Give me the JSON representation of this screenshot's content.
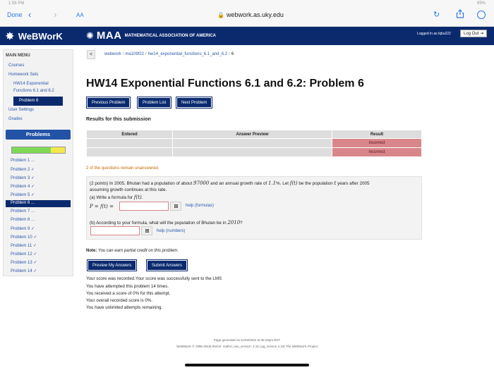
{
  "safari": {
    "done": "Done",
    "aa": "AA",
    "url": "webwork.as.uky.edu",
    "status_time": "1:56 PM",
    "status_right": "89%"
  },
  "header": {
    "logo": "WeBWorK",
    "maa_big": "MAA",
    "maa_small": "MATHEMATICAL ASSOCIATION OF AMERICA",
    "logged_in": "Logged in as lqbu222",
    "logout": "Log Out"
  },
  "sidebar": {
    "menu_title": "MAIN MENU",
    "courses": "Courses",
    "homework_sets": "Homework Sets",
    "hw_line1": "HW14 Exponential",
    "hw_line2": "Functions 6.1 and 6.2",
    "problem_active": "Problem 6",
    "user_settings": "User Settings",
    "grades": "Grades",
    "problems_title": "Problems",
    "progress": {
      "correct_fraction": 0.84,
      "attempted_fraction": 0.26
    },
    "problems": [
      "Problem 1 ...",
      "Problem 2 ✓",
      "Problem 3 ✓",
      "Problem 4 ✓",
      "Problem 5 ✓",
      "Problem 6 ...",
      "Problem 7 ...",
      "Problem 8 ...",
      "Problem 9 ✓",
      "Problem 10 ✓",
      "Problem 11 ✓",
      "Problem 12 ✓",
      "Problem 13 ✓",
      "Problem 14 ✓"
    ]
  },
  "breadcrumb": {
    "back": "<",
    "c1": "webwork",
    "c2": "ma109f22",
    "c3": "hw14_exponential_functions_6.1_and_6.2",
    "c4": "6",
    "sep": "/"
  },
  "title": "HW14 Exponential Functions 6.1 and 6.2: Problem 6",
  "buttons": {
    "previous": "Previous Problem",
    "list": "Problem List",
    "next": "Next Problem",
    "preview": "Preview My Answers",
    "submit": "Submit Answers"
  },
  "results": {
    "title": "Results for this submission",
    "headers": [
      "Entered",
      "Answer Preview",
      "Result"
    ],
    "rows": [
      {
        "entered": "",
        "preview": "",
        "result": "incorrect"
      },
      {
        "entered": "",
        "preview": "",
        "result": "incorrect"
      }
    ],
    "unanswered": "2 of the questions remain unanswered."
  },
  "problem": {
    "p1a": "(2 points) In 2005, Bhutan had a population of about ",
    "pop": "97000",
    "p1b": " and an annual growth rate of ",
    "rate": "1.1",
    "p1c": "%. Let ",
    "ft": "f(t)",
    "p1d": " be the population ",
    "t": "t",
    "p1e": " years after 2005",
    "p2": "assuming growth continues at this rate.",
    "p3a": "(a) Write a formula for ",
    "p3b": ".",
    "formula_label": "P = f(t) =",
    "help_formulas": "help (formulas)",
    "p4a": "(b) According to your formula, what will the population of Bhutan be in ",
    "year": "2010",
    "p4b": "?",
    "help_numbers": "help (numbers)"
  },
  "note": {
    "label": "Note:",
    "text": " You can earn partial credit on this problem."
  },
  "messages": [
    "Your score was recorded.Your score was successfully sent to the LMS",
    "You have attempted this problem 14 times.",
    "You received a score of 0% for this attempt.",
    "Your overall recorded score is 0%.",
    "You have unlimited attempts remaining."
  ],
  "footer": {
    "line1": "Page generated at 11/03/2022 at 05:15pm EDT",
    "line2": "WeBWorK © 1996-2019| theme: math4 | ww_version: 2.15 | pg_version 2.15| The WeBWorK Project"
  },
  "colors": {
    "navy": "#0b2a6e",
    "incorrect": "#d9868a",
    "link": "#2b57a8",
    "warning": "#c56a00"
  }
}
